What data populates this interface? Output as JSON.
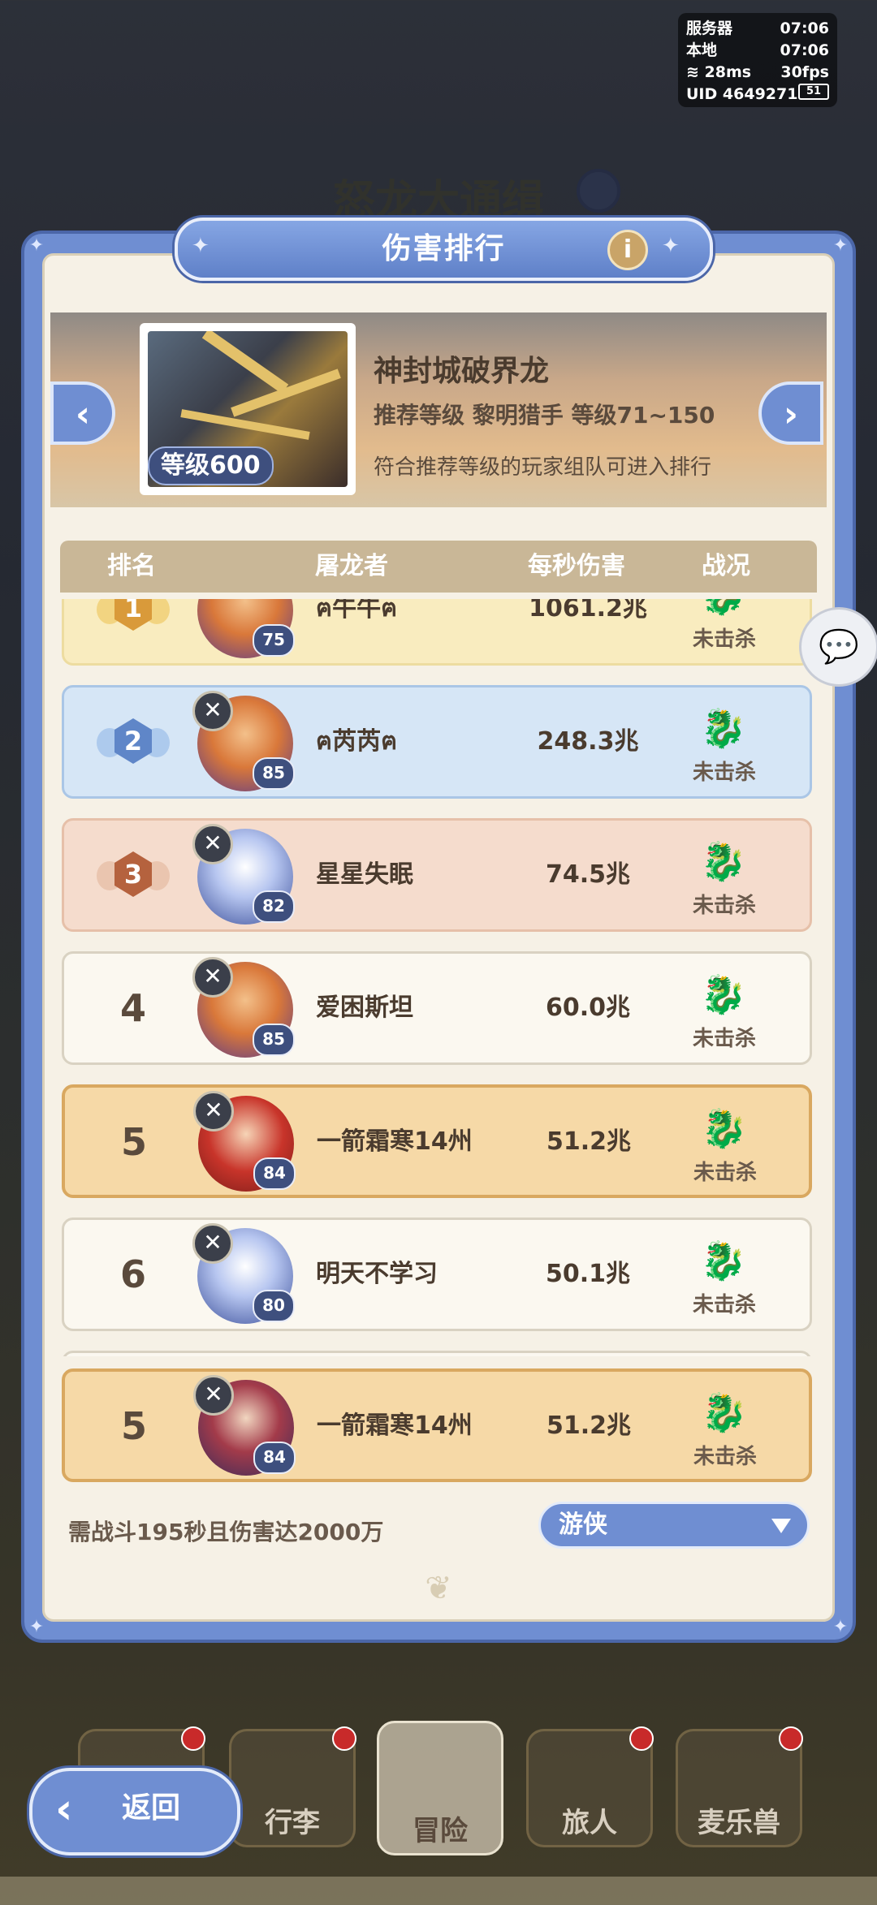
{
  "status": {
    "server_label": "服务器",
    "server_time": "07:06",
    "local_label": "本地",
    "local_time": "07:06",
    "ping": "28ms",
    "fps": "30fps",
    "uid_label": "UID",
    "uid": "4649271",
    "battery": "51"
  },
  "background": {
    "title": "怒龙大通缉"
  },
  "dialog": {
    "title": "伤害排行"
  },
  "boss": {
    "name": "神封城破界龙",
    "level_badge": "等级600",
    "recommend": "推荐等级  黎明猎手  等级71~150",
    "note": "符合推荐等级的玩家组队可进入排行"
  },
  "table": {
    "headers": {
      "rank": "排名",
      "player": "屠龙者",
      "dps": "每秒伤害",
      "status": "战况"
    }
  },
  "rows": [
    {
      "rank": "1",
      "name": "ฅ牛牛ฅ",
      "level": "75",
      "dps": "1061.2兆",
      "status": "未击杀"
    },
    {
      "rank": "2",
      "name": "ฅ芮芮ฅ",
      "level": "85",
      "dps": "248.3兆",
      "status": "未击杀"
    },
    {
      "rank": "3",
      "name": "星星失眠",
      "level": "82",
      "dps": "74.5兆",
      "status": "未击杀"
    },
    {
      "rank": "4",
      "name": "爱困斯坦",
      "level": "85",
      "dps": "60.0兆",
      "status": "未击杀"
    },
    {
      "rank": "5",
      "name": "一箭霜寒14州",
      "level": "84",
      "dps": "51.2兆",
      "status": "未击杀"
    },
    {
      "rank": "6",
      "name": "明天不学习",
      "level": "80",
      "dps": "50.1兆",
      "status": "未击杀"
    }
  ],
  "self": {
    "rank": "5",
    "name": "一箭霜寒14州",
    "level": "84",
    "dps": "51.2兆",
    "status": "未击杀"
  },
  "footer": {
    "requirement": "需战斗195秒且伤害达2000万",
    "class_select": "游侠"
  },
  "nav": {
    "back": "返回",
    "tabs": [
      "行李",
      "冒险",
      "旅人",
      "麦乐兽"
    ]
  }
}
